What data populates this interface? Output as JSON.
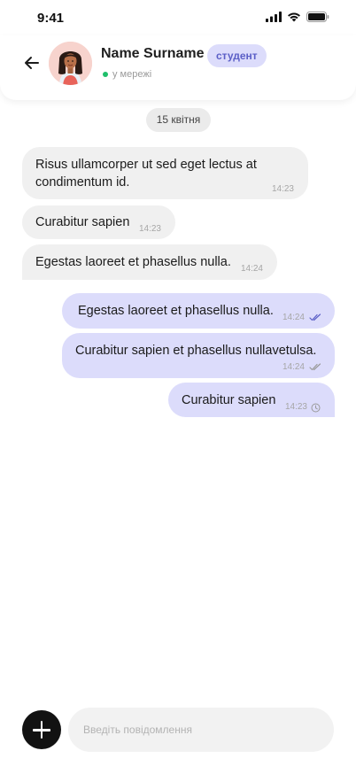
{
  "status_bar": {
    "time": "9:41"
  },
  "header": {
    "name": "Name Surname",
    "badge": "студент",
    "status": "у мережі"
  },
  "date_chip": "15 квітня",
  "messages": [
    {
      "direction": "incoming",
      "text": "Risus ullamcorper ut sed eget lectus at condimentum id.",
      "time": "14:23"
    },
    {
      "direction": "incoming",
      "text": "Curabitur sapien",
      "time": "14:23"
    },
    {
      "direction": "incoming",
      "text": "Egestas laoreet et phasellus nulla.",
      "time": "14:24"
    },
    {
      "direction": "outgoing",
      "text": "Egestas laoreet et phasellus nulla.",
      "time": "14:24",
      "status": "read"
    },
    {
      "direction": "outgoing",
      "text": "Curabitur sapien et phasellus nullavetulsa.",
      "time": "14:24",
      "status": "delivered"
    },
    {
      "direction": "outgoing",
      "text": "Curabitur sapien",
      "time": "14:23",
      "status": "pending"
    }
  ],
  "composer": {
    "placeholder": "Введіть повідомлення"
  },
  "colors": {
    "incoming_bubble": "#f0f0f0",
    "outgoing_bubble": "#dcdcfb",
    "badge_text": "#5b5fc7",
    "online": "#1fbf6b",
    "read_check": "#5b5fc7"
  }
}
